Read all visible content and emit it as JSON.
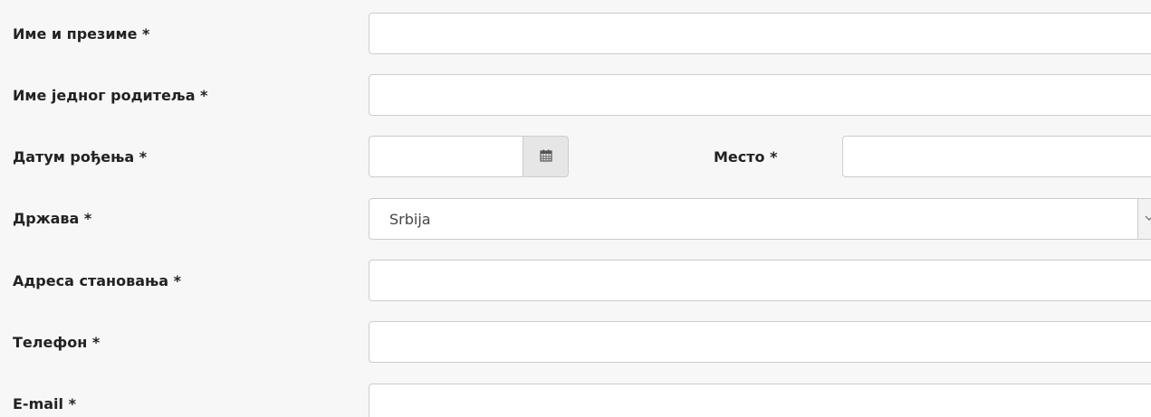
{
  "form": {
    "full_name_label": "Име и презиме *",
    "parent_name_label": "Име једног родитеља *",
    "birth_date_label": "Датум рођења *",
    "place_label": "Место *",
    "country_label": "Држава *",
    "country_selected": "Srbija",
    "address_label": "Адреса становања *",
    "phone_label": "Телефон *",
    "email_label": "E-mail *"
  },
  "icons": {
    "calendar": "calendar-icon",
    "dropdown": "chevron-down-icon"
  },
  "colors": {
    "page_background": "#f7f7f7",
    "input_border": "#cccccc",
    "addon_background": "#e6e6e6",
    "label_text": "#222222"
  }
}
